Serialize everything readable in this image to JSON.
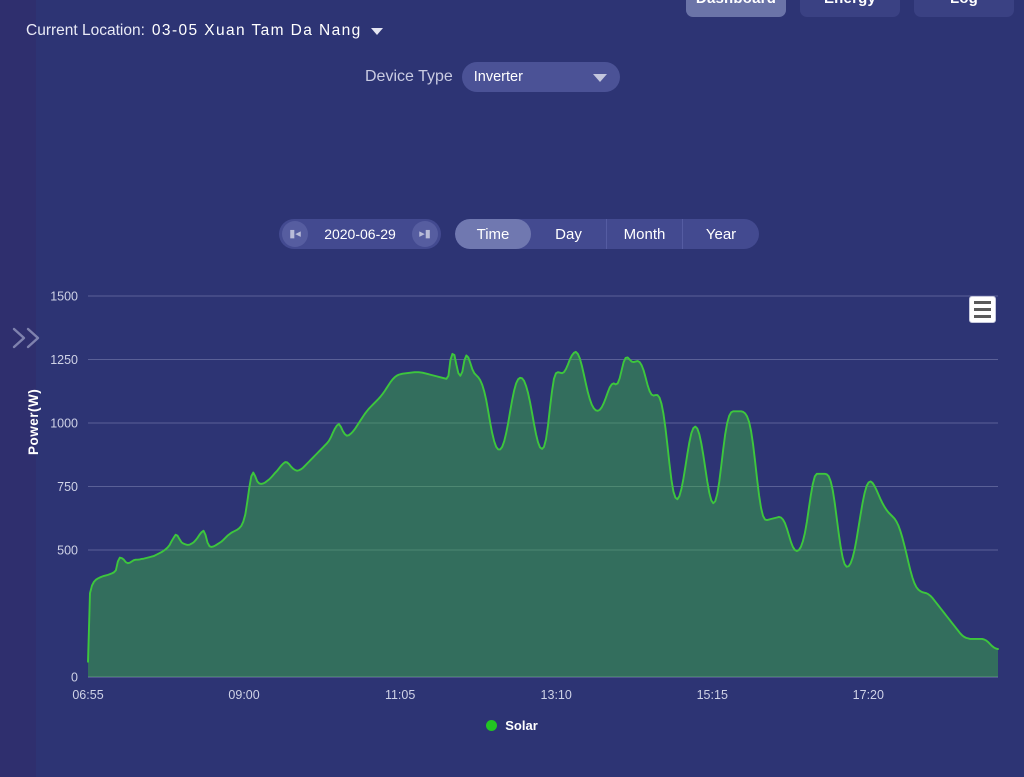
{
  "topnav": {
    "tabs": [
      {
        "label": "Dashboard",
        "active": true
      },
      {
        "label": "Energy",
        "active": false
      },
      {
        "label": "Log",
        "active": false
      }
    ]
  },
  "location": {
    "label": "Current Location:",
    "value": "03-05 Xuan Tam Da Nang",
    "caret_icon": "caret-down-icon"
  },
  "device_type": {
    "label": "Device Type",
    "value": "Inverter",
    "arrow_icon": "chevron-down-icon"
  },
  "date_picker": {
    "value": "2020-06-29",
    "prev_icon": "step-backward-icon",
    "next_icon": "step-forward-icon"
  },
  "range_tabs": [
    {
      "label": "Time",
      "active": true
    },
    {
      "label": "Day",
      "active": false
    },
    {
      "label": "Month",
      "active": false
    },
    {
      "label": "Year",
      "active": false
    }
  ],
  "chart_menu": {
    "icon": "hamburger-menu-icon"
  },
  "rail": {
    "expand_icon": "double-chevron-right-icon"
  },
  "colors": {
    "background": "#2d3474",
    "line": "#3dc63d",
    "area_fill": "#30536b",
    "accent_active": "#7078b0",
    "grid": "#7f84b4"
  },
  "chart_data": {
    "type": "area",
    "title": "",
    "xlabel": "",
    "ylabel": "Power(W)",
    "ylim": [
      0,
      1500
    ],
    "yticks": [
      0,
      500,
      750,
      1000,
      1250,
      1500
    ],
    "grid": true,
    "legend_position": "bottom",
    "xtick_labels": [
      "06:55",
      "09:00",
      "11:05",
      "13:10",
      "15:15",
      "17:20"
    ],
    "xtick_times": [
      "06:55",
      "09:00",
      "11:05",
      "13:10",
      "15:15",
      "17:20"
    ],
    "x_start": "06:55",
    "x_end": "18:50",
    "series": [
      {
        "name": "Solar",
        "color": "#3dc63d",
        "values": [
          60,
          330,
          360,
          375,
          383,
          388,
          392,
          395,
          398,
          400,
          402,
          405,
          408,
          412,
          420,
          455,
          470,
          468,
          462,
          452,
          448,
          450,
          455,
          460,
          462,
          462,
          463,
          465,
          466,
          468,
          470,
          472,
          474,
          476,
          480,
          484,
          488,
          492,
          497,
          503,
          510,
          520,
          535,
          548,
          560,
          556,
          542,
          530,
          525,
          522,
          520,
          521,
          525,
          530,
          538,
          548,
          560,
          570,
          576,
          560,
          530,
          515,
          512,
          514,
          518,
          523,
          528,
          533,
          540,
          548,
          556,
          562,
          568,
          572,
          576,
          580,
          586,
          595,
          612,
          640,
          690,
          745,
          790,
          805,
          790,
          770,
          762,
          760,
          762,
          766,
          772,
          778,
          786,
          795,
          804,
          812,
          822,
          832,
          840,
          846,
          845,
          838,
          828,
          820,
          815,
          812,
          814,
          818,
          824,
          832,
          840,
          848,
          856,
          864,
          872,
          880,
          888,
          896,
          904,
          912,
          920,
          930,
          944,
          962,
          978,
          990,
          996,
          985,
          968,
          956,
          950,
          952,
          958,
          966,
          976,
          988,
          1000,
          1012,
          1024,
          1036,
          1046,
          1056,
          1064,
          1072,
          1080,
          1088,
          1096,
          1105,
          1115,
          1126,
          1138,
          1150,
          1162,
          1172,
          1180,
          1186,
          1190,
          1192,
          1194,
          1195,
          1196,
          1197,
          1198,
          1199,
          1200,
          1200,
          1200,
          1199,
          1198,
          1196,
          1194,
          1192,
          1190,
          1188,
          1186,
          1184,
          1182,
          1180,
          1178,
          1176,
          1174,
          1186,
          1248,
          1272,
          1268,
          1230,
          1196,
          1186,
          1202,
          1246,
          1266,
          1258,
          1236,
          1212,
          1196,
          1188,
          1180,
          1168,
          1150,
          1124,
          1090,
          1046,
          1000,
          960,
          928,
          906,
          896,
          896,
          906,
          928,
          960,
          1000,
          1046,
          1090,
          1128,
          1156,
          1172,
          1178,
          1176,
          1166,
          1146,
          1118,
          1082,
          1040,
          996,
          956,
          924,
          904,
          898,
          906,
          936,
          990,
          1060,
          1124,
          1174,
          1196,
          1200,
          1198,
          1196,
          1200,
          1212,
          1230,
          1250,
          1266,
          1276,
          1280,
          1272,
          1254,
          1226,
          1192,
          1156,
          1122,
          1094,
          1072,
          1058,
          1050,
          1048,
          1052,
          1062,
          1078,
          1098,
          1120,
          1140,
          1152,
          1156,
          1152,
          1156,
          1176,
          1208,
          1240,
          1256,
          1258,
          1250,
          1242,
          1240,
          1242,
          1244,
          1240,
          1228,
          1208,
          1180,
          1150,
          1126,
          1112,
          1108,
          1110,
          1110,
          1100,
          1076,
          1036,
          980,
          912,
          840,
          776,
          730,
          706,
          700,
          712,
          740,
          780,
          828,
          878,
          924,
          960,
          980,
          986,
          978,
          956,
          920,
          874,
          822,
          770,
          726,
          696,
          684,
          692,
          720,
          768,
          830,
          896,
          956,
          1000,
          1028,
          1042,
          1046,
          1046,
          1046,
          1046,
          1046,
          1044,
          1038,
          1026,
          1004,
          968,
          916,
          850,
          780,
          716,
          666,
          634,
          620,
          618,
          620,
          622,
          624,
          626,
          628,
          630,
          628,
          620,
          606,
          584,
          558,
          532,
          512,
          500,
          496,
          500,
          512,
          534,
          566,
          610,
          664,
          716,
          760,
          790,
          800,
          800,
          800,
          800,
          800,
          798,
          790,
          770,
          736,
          686,
          626,
          566,
          512,
          470,
          444,
          434,
          436,
          448,
          470,
          502,
          544,
          592,
          640,
          686,
          724,
          752,
          766,
          770,
          764,
          752,
          736,
          718,
          700,
          684,
          670,
          658,
          648,
          640,
          632,
          624,
          612,
          596,
          574,
          548,
          518,
          486,
          452,
          420,
          392,
          370,
          354,
          344,
          338,
          334,
          332,
          330,
          326,
          320,
          312,
          302,
          292,
          282,
          272,
          262,
          252,
          242,
          232,
          222,
          212,
          202,
          192,
          182,
          172,
          164,
          158,
          154,
          152,
          150,
          150,
          150,
          150,
          150,
          150,
          150,
          148,
          144,
          138,
          130,
          122,
          116,
          112,
          110
        ]
      }
    ]
  }
}
